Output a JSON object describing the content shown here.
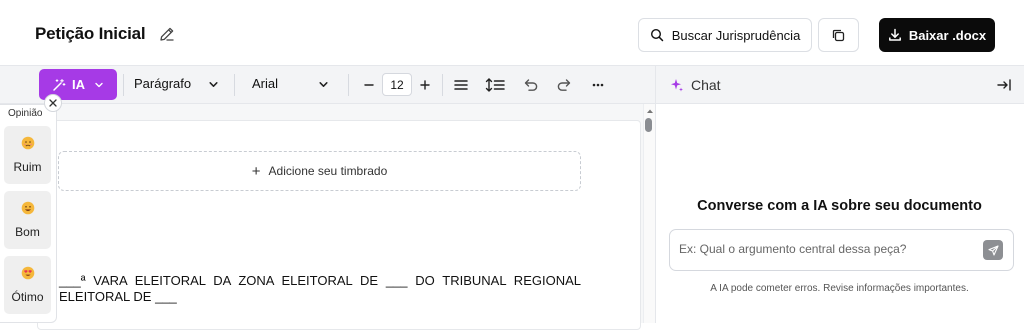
{
  "header": {
    "title": "Petição Inicial",
    "search_button": "Buscar Jurisprudência",
    "download_button": "Baixar .docx"
  },
  "toolbar": {
    "ia_label": "IA",
    "paragraph_style": "Parágrafo",
    "font_family": "Arial",
    "font_size": "12"
  },
  "chat": {
    "title": "Chat",
    "headline": "Converse com a IA sobre seu documento",
    "input_placeholder": "Ex: Qual o argumento central dessa peça?",
    "disclaimer": "A IA pode cometer erros. Revise informações importantes."
  },
  "editor": {
    "letterhead_label": "Adicione seu timbrado",
    "body_text": "___ª VARA ELEITORAL DA ZONA ELEITORAL DE ___ DO TRIBUNAL REGIONAL ELEITORAL DE ___"
  },
  "opinion": {
    "title": "Opinião",
    "options": [
      {
        "label": "Ruim",
        "icon": "sad-face-icon"
      },
      {
        "label": "Bom",
        "icon": "smile-face-icon"
      },
      {
        "label": "Ótimo",
        "icon": "heart-eyes-face-icon"
      }
    ]
  },
  "colors": {
    "accent": "#a63ae6",
    "download_bg": "#0b0b0b"
  }
}
